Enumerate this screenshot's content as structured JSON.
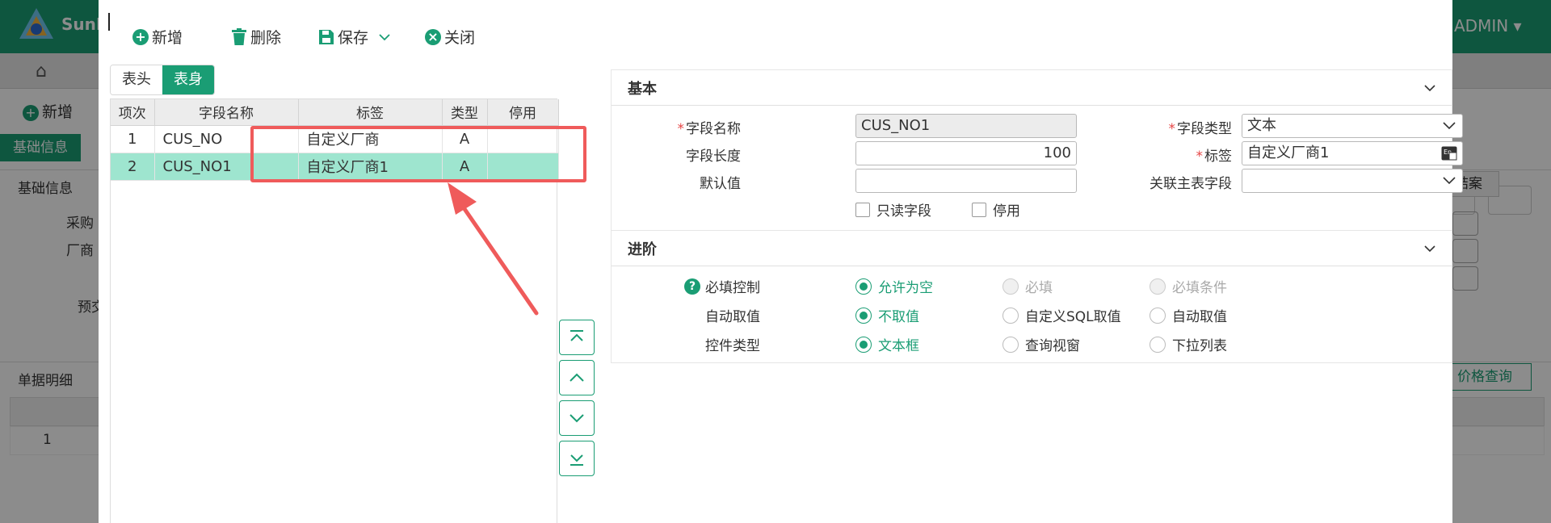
{
  "background": {
    "brand": "SunF",
    "user": "ADMIN ▾",
    "new_label": "新增",
    "tab_basic": "基础信息",
    "section1": "基础信息",
    "field1": "采购",
    "field2": "厂商",
    "field3": "预交",
    "section2": "单据明细",
    "row1": "1",
    "settle_btn": "结案",
    "price_btn": "价格查询"
  },
  "toolbar": {
    "new_label": "新增",
    "delete_label": "删除",
    "save_label": "保存",
    "close_label": "关闭"
  },
  "tabs": [
    {
      "label": "表头"
    },
    {
      "label": "表身"
    }
  ],
  "grid": {
    "columns": [
      "项次",
      "字段名称",
      "标签",
      "类型",
      "停用"
    ],
    "rows": [
      {
        "idx": "1",
        "name": "CUS_NO",
        "label": "自定义厂商",
        "type": "A",
        "disabled": ""
      },
      {
        "idx": "2",
        "name": "CUS_NO1",
        "label": "自定义厂商1",
        "type": "A",
        "disabled": ""
      }
    ]
  },
  "basic": {
    "title": "基本",
    "field_name_label": "字段名称",
    "field_name_value": "CUS_NO1",
    "field_type_label": "字段类型",
    "field_type_value": "文本",
    "field_length_label": "字段长度",
    "field_length_value": "100",
    "tag_label": "标签",
    "tag_value": "自定义厂商1",
    "default_label": "默认值",
    "default_value": "",
    "linked_label": "关联主表字段",
    "linked_value": "",
    "readonly_label": "只读字段",
    "disable_label": "停用"
  },
  "advanced": {
    "title": "进阶",
    "required_label": "必填控制",
    "required_opts": [
      "允许为空",
      "必填",
      "必填条件"
    ],
    "auto_label": "自动取值",
    "auto_opts": [
      "不取值",
      "自定义SQL取值",
      "自动取值"
    ],
    "control_label": "控件类型",
    "control_opts": [
      "文本框",
      "查询视窗",
      "下拉列表"
    ]
  },
  "colors": {
    "accent": "#1a9d74",
    "selected_row": "#9ee5cf",
    "highlight": "#ef5b5b"
  }
}
